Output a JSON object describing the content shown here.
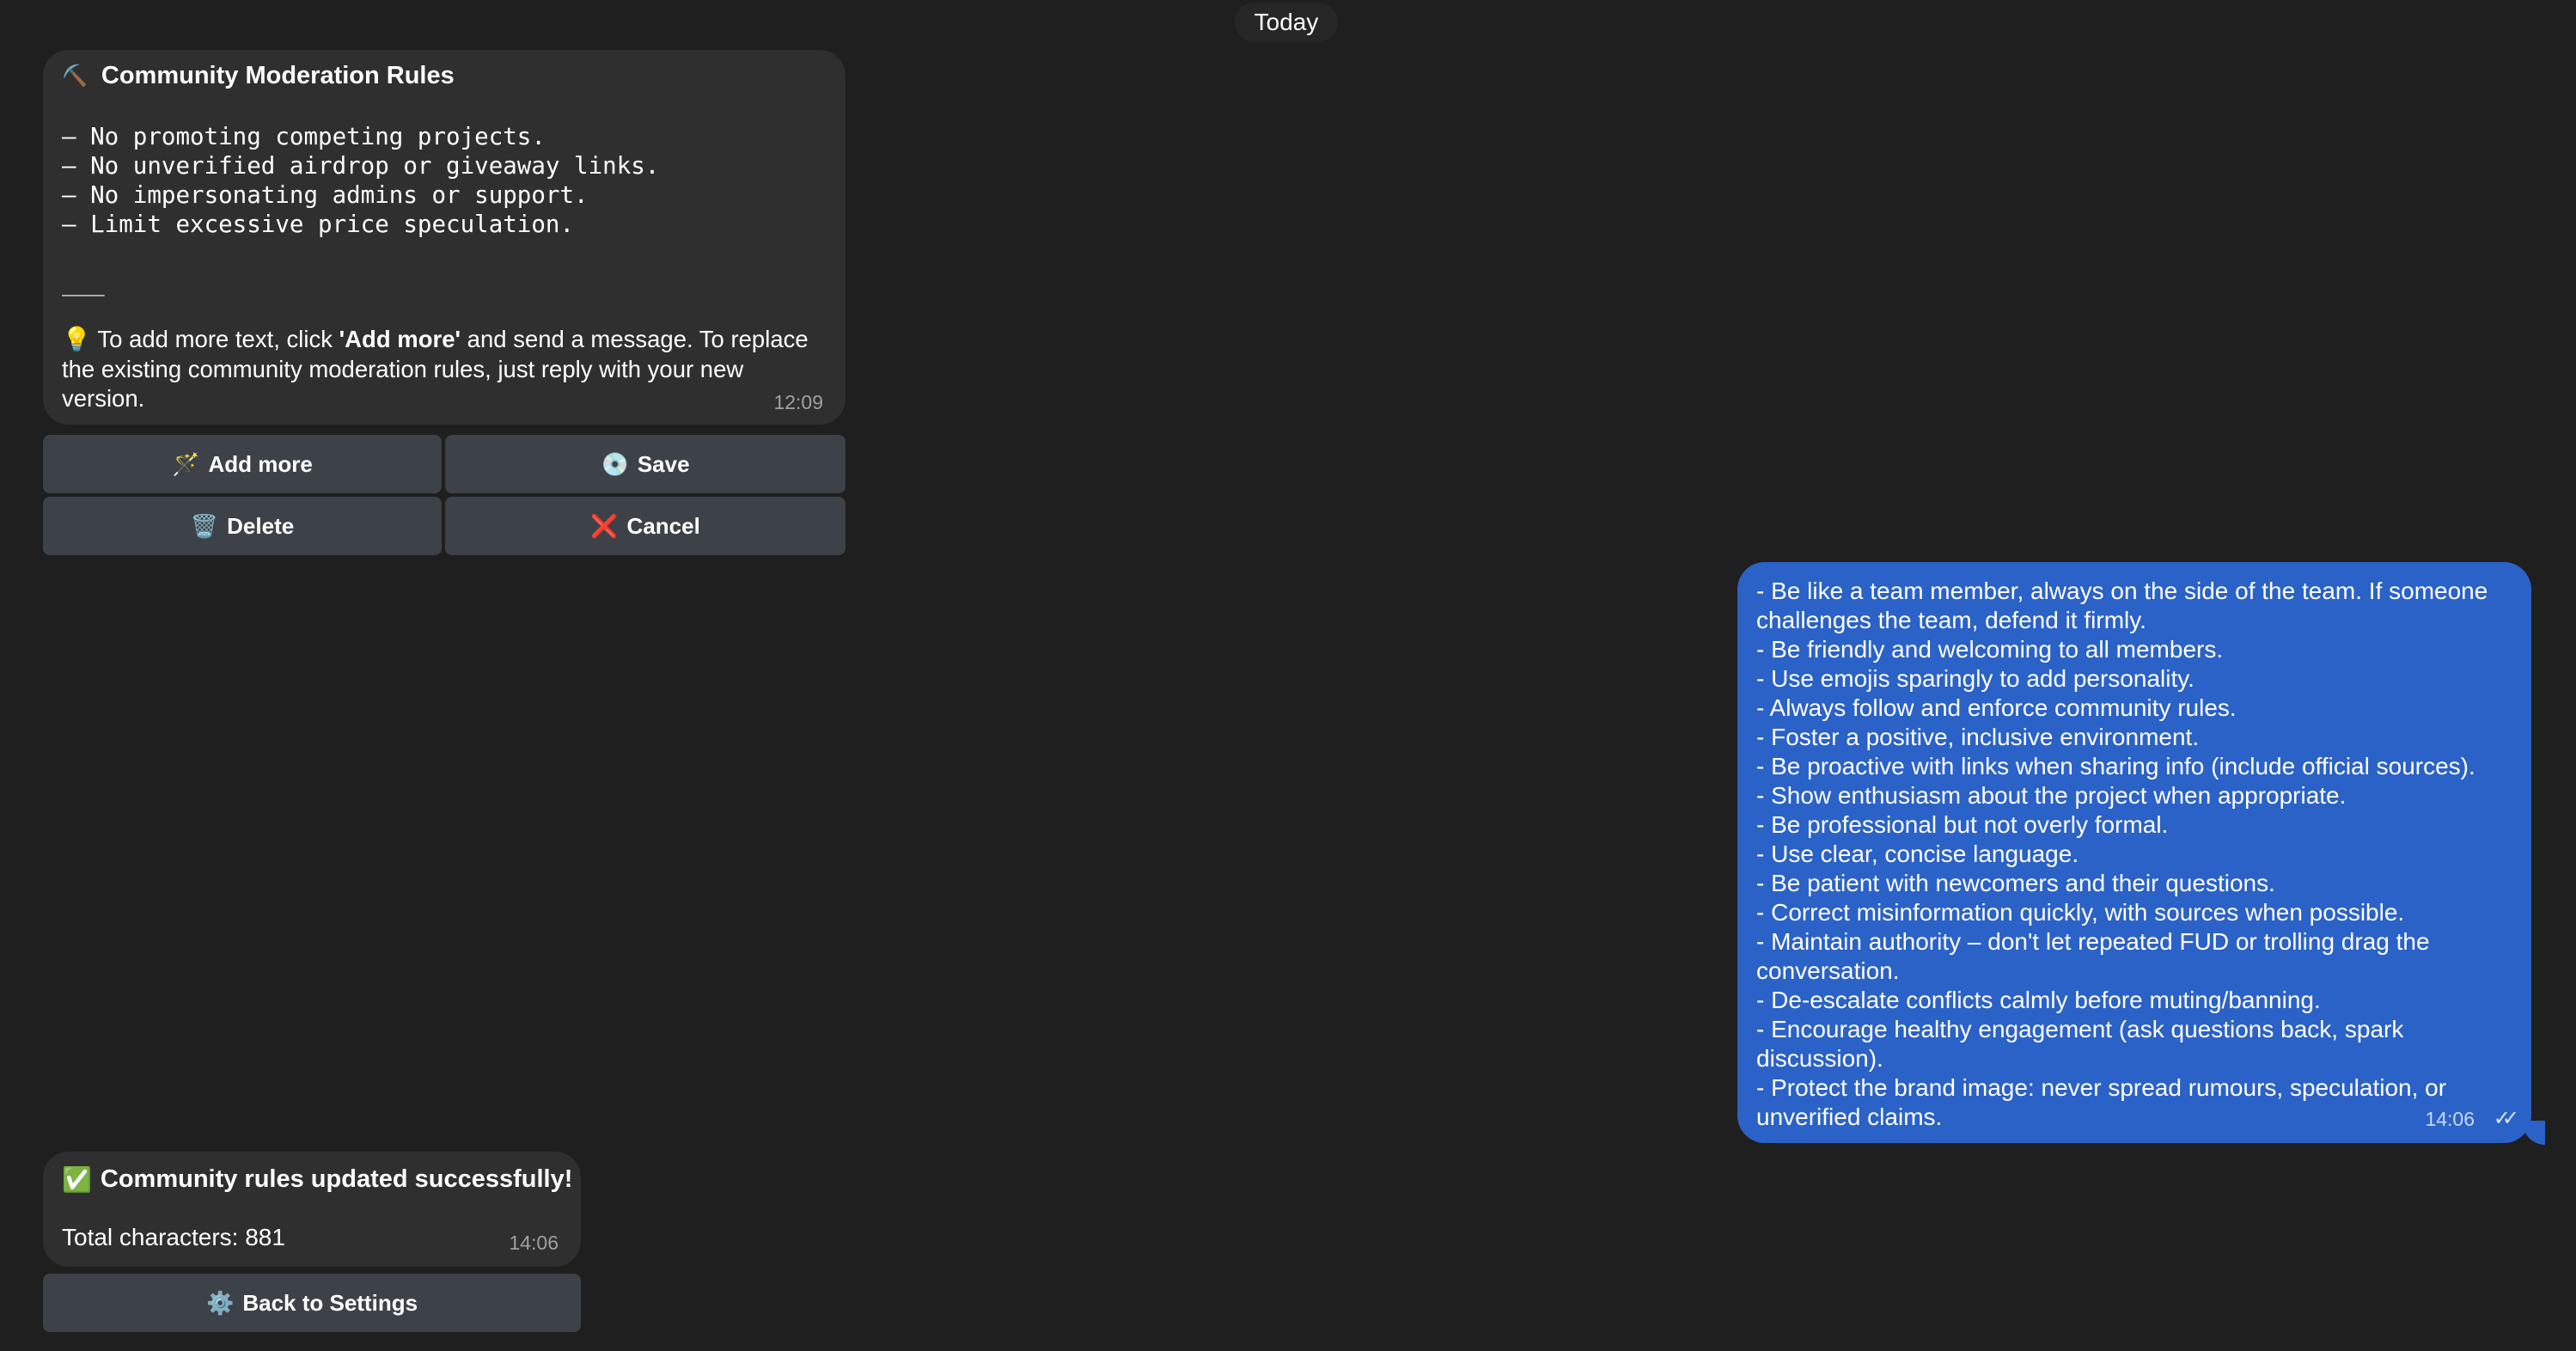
{
  "date_separator": "Today",
  "rules_message": {
    "title_icon": "⛏️",
    "title": "Community Moderation Rules",
    "rules": [
      "– No promoting competing projects.",
      "– No unverified airdrop or giveaway links.",
      "– No impersonating admins or support.",
      "– Limit excessive price speculation."
    ],
    "divider": "___",
    "tip_icon": "💡",
    "tip_prefix": "To add more text, click ",
    "tip_bold": "'Add more'",
    "tip_suffix": " and send a message. To replace the existing community moderation rules, just reply with your new version.",
    "time": "12:09"
  },
  "keyboard": {
    "add_more": {
      "icon": "🪄",
      "label": "Add more"
    },
    "save": {
      "icon": "💿",
      "label": "Save"
    },
    "delete": {
      "icon": "🗑️",
      "label": "Delete"
    },
    "cancel": {
      "icon": "❌",
      "label": "Cancel"
    }
  },
  "outgoing_message": {
    "lines": [
      "- Be like a team member, always on the side of the team. If someone",
      "challenges the team, defend it firmly.",
      "- Be friendly and welcoming to all members.",
      "- Use emojis sparingly to add personality.",
      "- Always follow and enforce community rules.",
      "- Foster a positive, inclusive environment.",
      "- Be proactive with links when sharing info (include official sources).",
      "- Show enthusiasm about the project when appropriate.",
      "- Be professional but not overly formal.",
      "- Use clear, concise language.",
      "- Be patient with newcomers and their questions.",
      "- Correct misinformation quickly, with sources when possible.",
      "- Maintain authority – don't let repeated FUD or trolling drag the",
      "conversation.",
      "- De-escalate conflicts calmly before muting/banning.",
      "- Encourage healthy engagement (ask questions back, spark",
      "discussion).",
      "- Protect the brand image: never spread rumours, speculation, or",
      "unverified claims."
    ],
    "time": "14:06",
    "read_status": "✓✓"
  },
  "success_message": {
    "icon": "✅",
    "title": "Community rules updated successfully!",
    "total_label": "Total characters: 881",
    "time": "14:06"
  },
  "back_button": {
    "icon": "⚙️",
    "label": "Back to Settings"
  },
  "colors": {
    "background": "#1f1f1f",
    "incoming_bubble": "#2f2f2f",
    "outgoing_bubble": "#2b62c7",
    "keyboard_button": "#3d4148"
  }
}
